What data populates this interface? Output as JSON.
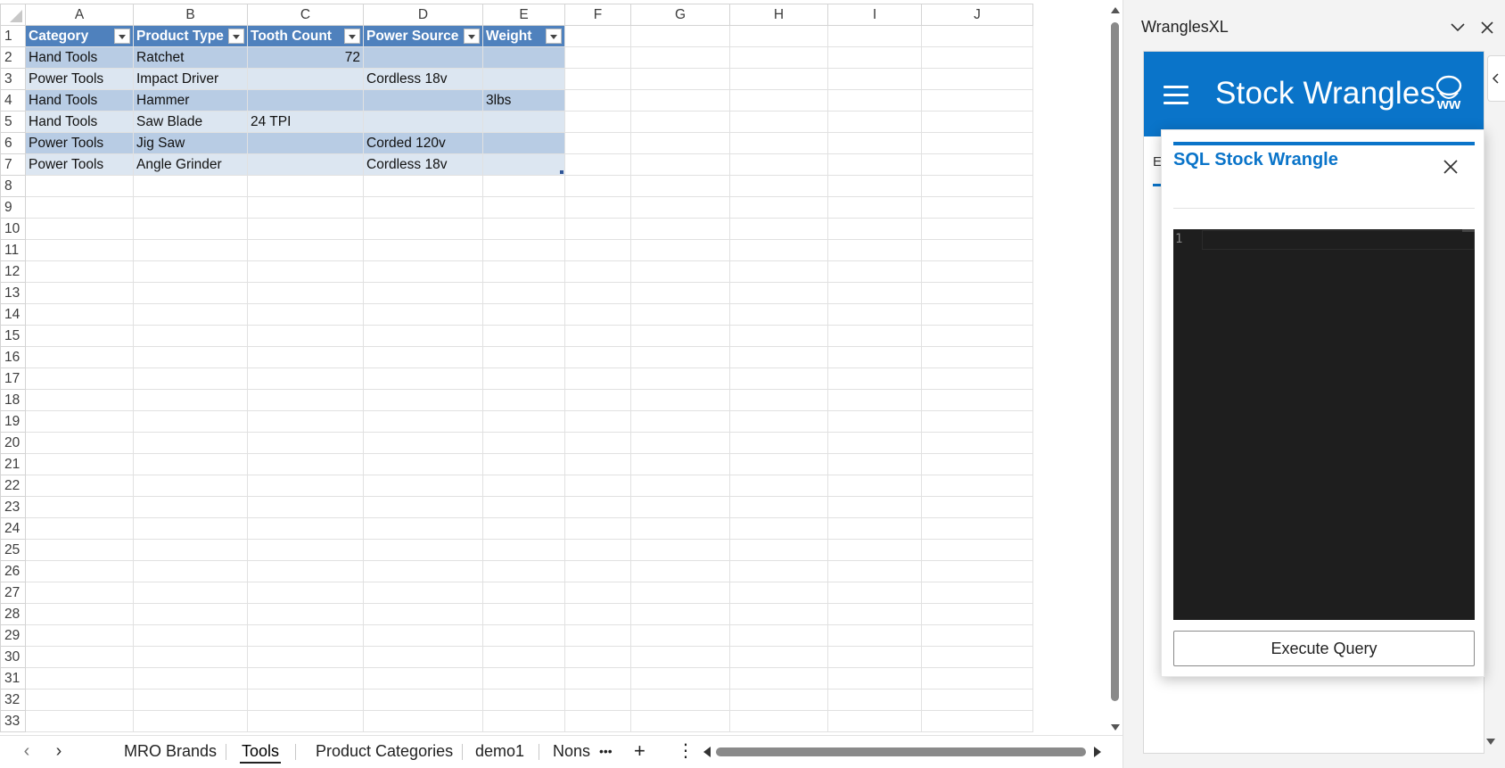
{
  "columns": [
    "A",
    "B",
    "C",
    "D",
    "E",
    "F",
    "G",
    "H",
    "I",
    "J"
  ],
  "row_numbers": [
    "1",
    "2",
    "3",
    "4",
    "5",
    "6",
    "7",
    "8",
    "9",
    "10",
    "11",
    "12",
    "13",
    "14",
    "15",
    "16",
    "17",
    "18",
    "19",
    "20",
    "21",
    "22",
    "23",
    "24",
    "25",
    "26",
    "27",
    "28",
    "29",
    "30",
    "31",
    "32",
    "33"
  ],
  "table": {
    "headers": [
      "Category",
      "Product Type",
      "Tooth Count",
      "Power Source",
      "Weight"
    ],
    "rows": [
      [
        "Hand Tools",
        "Ratchet",
        "72",
        "",
        ""
      ],
      [
        "Power Tools",
        "Impact Driver",
        "",
        "Cordless 18v",
        ""
      ],
      [
        "Hand Tools",
        "Hammer",
        "",
        "",
        "3lbs"
      ],
      [
        "Hand Tools",
        "Saw Blade",
        "24 TPI",
        "",
        ""
      ],
      [
        "Power Tools",
        "Jig Saw",
        "",
        "Corded 120v",
        ""
      ],
      [
        "Power Tools",
        "Angle Grinder",
        "",
        "Cordless 18v",
        ""
      ]
    ],
    "header_color": "#4f81bd",
    "band_colors": [
      "#b8cce4",
      "#dce6f1"
    ]
  },
  "sheet_tabs": {
    "prev_icon": "chevron-left-icon",
    "next_icon": "chevron-right-icon",
    "tabs": [
      "MRO Brands",
      "Tools",
      "Product Categories",
      "demo1",
      "Nons"
    ],
    "active": "Tools",
    "more_glyph": "•••",
    "add_glyph": "+",
    "options_glyph": "⋮"
  },
  "pane": {
    "title": "WranglesXL",
    "brand": "Stock Wrangles",
    "logo_text": "ww",
    "tab_peek": "E",
    "accent": "#0a74c9"
  },
  "dialog": {
    "title": "SQL Stock Wrangle",
    "editor_line": "1",
    "execute_label": "Execute Query"
  }
}
